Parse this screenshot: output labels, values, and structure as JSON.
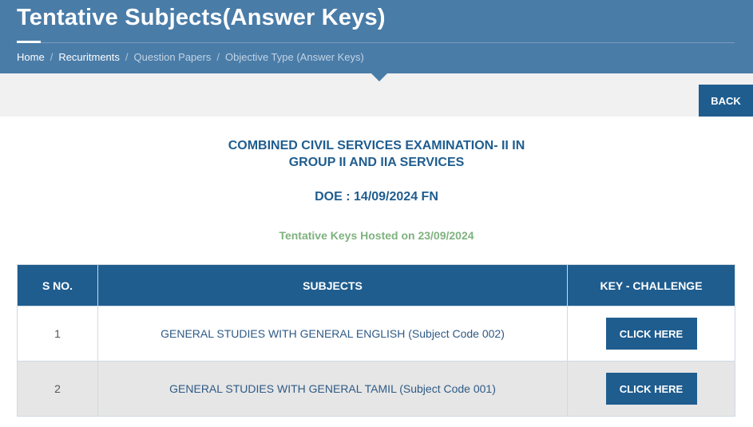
{
  "header": {
    "title": "Tentative Subjects(Answer Keys)",
    "breadcrumb": {
      "home": "Home",
      "recruitments": "Recuritments",
      "question_papers": "Question Papers",
      "objective_type": "Objective Type (Answer Keys)",
      "separator": "/"
    }
  },
  "toolbar": {
    "back_label": "BACK"
  },
  "exam": {
    "title_line1": "COMBINED CIVIL SERVICES EXAMINATION- II IN",
    "title_line2": "GROUP II AND IIA SERVICES",
    "doe": "DOE : 14/09/2024 FN",
    "hosted": "Tentative Keys Hosted on 23/09/2024"
  },
  "table": {
    "headers": {
      "sno": "S NO.",
      "subjects": "SUBJECTS",
      "key_challenge": "KEY - CHALLENGE"
    },
    "rows": [
      {
        "sno": "1",
        "subject": "GENERAL STUDIES WITH GENERAL ENGLISH (Subject Code 002)",
        "action": "CLICK HERE"
      },
      {
        "sno": "2",
        "subject": "GENERAL STUDIES WITH GENERAL TAMIL (Subject Code 001)",
        "action": "CLICK HERE"
      }
    ]
  },
  "colors": {
    "header_bg": "#4a7ca8",
    "primary": "#1f5d8f",
    "hosted_green": "#7fb27f",
    "band_gray": "#f1f1f1",
    "row_alt": "#e6e6e6"
  }
}
